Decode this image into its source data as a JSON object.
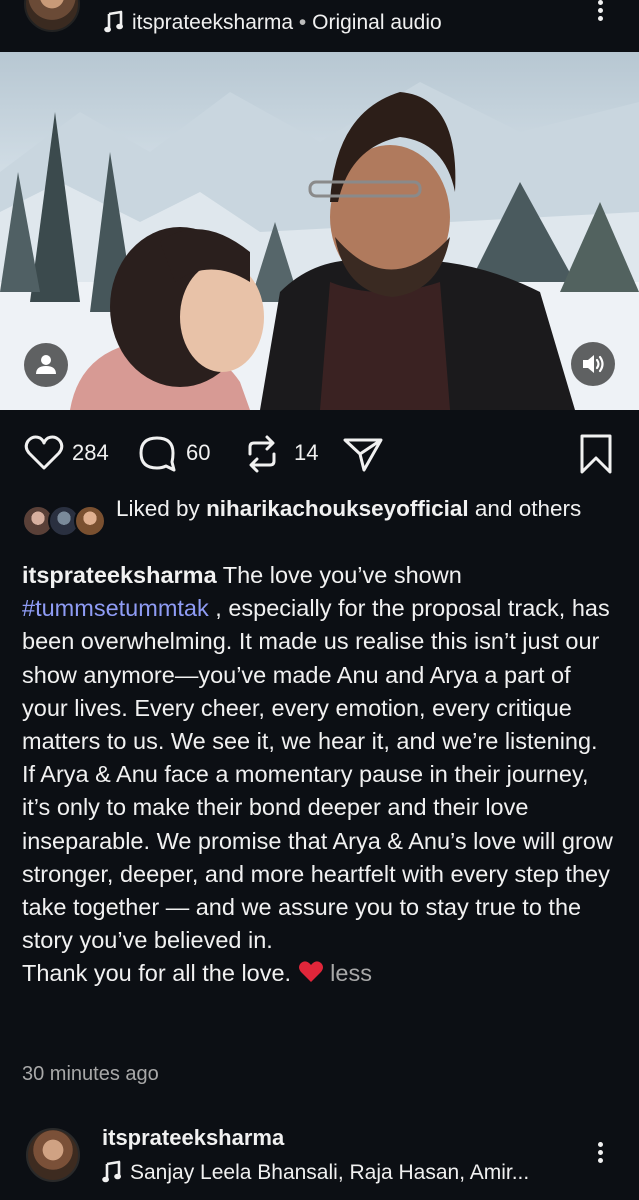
{
  "header": {
    "username": "itsprateeksharma",
    "separator": "•",
    "audio_label": "Original audio"
  },
  "actions": {
    "likes": "284",
    "comments": "60",
    "reposts": "14"
  },
  "liked_by": {
    "prefix": "Liked by ",
    "user": "niharikachoukseyofficial",
    "suffix": " and others"
  },
  "caption": {
    "username": "itsprateeksharma",
    "intro": " The love you’ve shown ",
    "hashtag": "#tummsetummtak",
    "body": " , especially for the proposal track, has been overwhelming.  It made us realise this isn’t just our show anymore—you’ve made Anu and Arya a part of your lives. Every cheer, every emotion, every critique matters to us. We see it, we hear it, and we’re listening.",
    "paragraph2": "If Arya & Anu face a momentary pause in their journey, it’s only to make their bond deeper and their love inseparable. We promise that Arya & Anu’s love will grow stronger, deeper, and more heartfelt with every step they take together — and we assure you to stay true to the story you’ve believed in.",
    "closing": "Thank you for all the love. ",
    "less": "less"
  },
  "timestamp": "30 minutes ago",
  "next_post": {
    "username": "itsprateeksharma",
    "audio": "Sanjay Leela Bhansali, Raja Hasan, Amir..."
  },
  "colors": {
    "background": "#0c0f14",
    "hashtag": "#8f9cf5",
    "muted": "#a8a8a8",
    "heart": "#e0263a"
  },
  "icons": [
    "music-note-icon",
    "more-options-icon",
    "person-icon",
    "sound-on-icon",
    "heart-icon",
    "comment-icon",
    "repost-icon",
    "share-icon",
    "bookmark-icon",
    "heart-emoji-icon"
  ]
}
